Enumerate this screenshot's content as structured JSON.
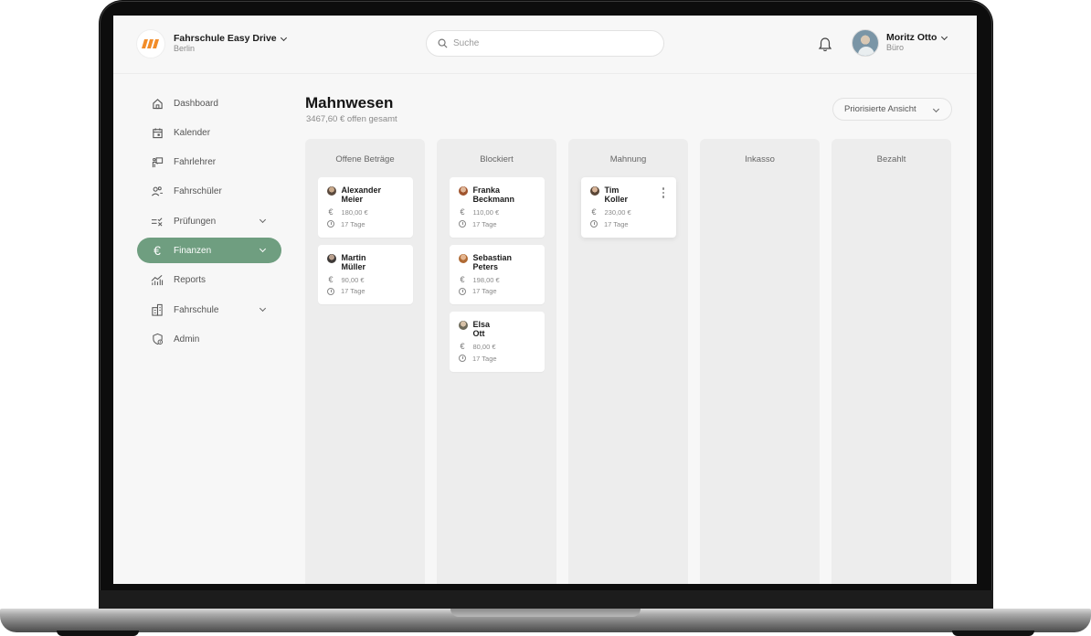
{
  "header": {
    "brand_name": "Fahrschule Easy Drive",
    "brand_city": "Berlin",
    "search_placeholder": "Suche",
    "user_name": "Moritz Otto",
    "user_role": "Büro"
  },
  "sidebar": {
    "items": [
      {
        "label": "Dashboard",
        "icon": "home-icon"
      },
      {
        "label": "Kalender",
        "icon": "calendar-icon"
      },
      {
        "label": "Fahrlehrer",
        "icon": "instructor-icon"
      },
      {
        "label": "Fahrschüler",
        "icon": "students-icon"
      },
      {
        "label": "Prüfungen",
        "icon": "exam-icon"
      },
      {
        "label": "Finanzen",
        "icon": "euro-icon"
      },
      {
        "label": "Reports",
        "icon": "chart-icon"
      },
      {
        "label": "Fahrschule",
        "icon": "building-icon"
      },
      {
        "label": "Admin",
        "icon": "admin-shield-icon"
      }
    ],
    "active": "Finanzen"
  },
  "main": {
    "title": "Mahnwesen",
    "subtitle": "3467,60 € offen gesamt",
    "view_select": "Priorisierte Ansicht",
    "columns": [
      {
        "title": "Offene Beträge",
        "cards": [
          {
            "first": "Alexander",
            "last": "Meier",
            "amount": "180,00 €",
            "days": "17 Tage"
          },
          {
            "first": "Martin",
            "last": "Müller",
            "amount": "90,00 €",
            "days": "17 Tage"
          }
        ]
      },
      {
        "title": "Blockiert",
        "cards": [
          {
            "first": "Franka",
            "last": "Beckmann",
            "amount": "110,00 €",
            "days": "17 Tage"
          },
          {
            "first": "Sebastian",
            "last": "Peters",
            "amount": "198,00 €",
            "days": "17 Tage"
          },
          {
            "first": "Elsa",
            "last": "Ott",
            "amount": "80,00 €",
            "days": "17 Tage"
          }
        ]
      },
      {
        "title": "Mahnung",
        "cards": [
          {
            "first": "Tim",
            "last": "Koller",
            "amount": "230,00 €",
            "days": "17 Tage"
          }
        ]
      },
      {
        "title": "Inkasso",
        "cards": []
      },
      {
        "title": "Bezahlt",
        "cards": []
      }
    ]
  },
  "colors": {
    "accent": "#6f9e80",
    "logo_orange": "#f28c28"
  }
}
